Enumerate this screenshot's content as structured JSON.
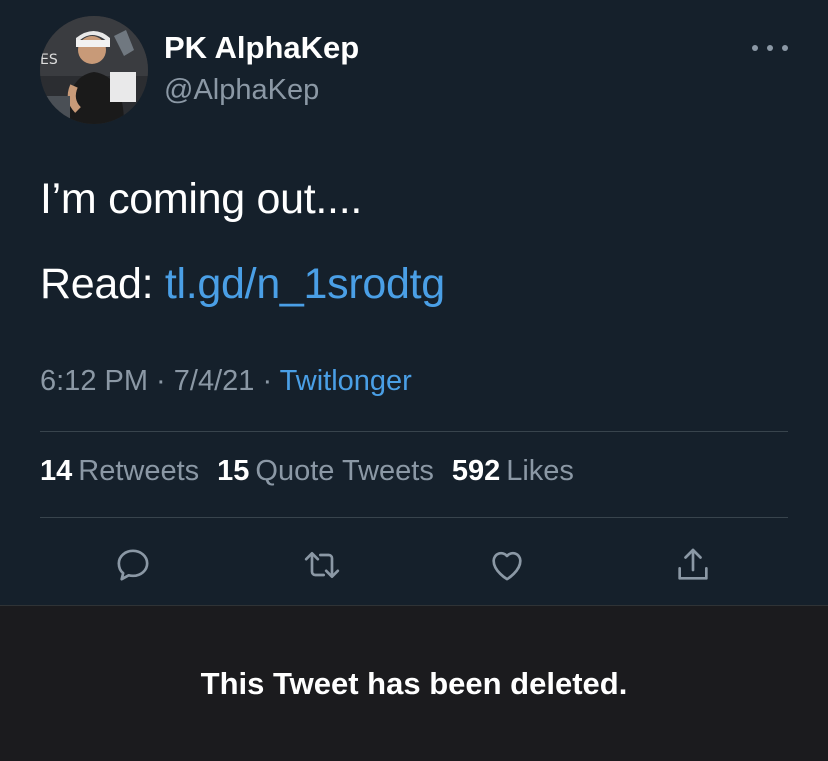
{
  "tweet": {
    "author": {
      "display_name": "PK AlphaKep",
      "handle": "@AlphaKep"
    },
    "text_line1": "I’m coming out....",
    "text_line2_prefix": "Read: ",
    "link_text": "tl.gd/n_1srodtg",
    "time": "6:12 PM",
    "separator": " · ",
    "date": "7/4/21",
    "source": "Twitlonger",
    "stats": {
      "retweets_count": "14",
      "retweets_label": "Retweets",
      "quotes_count": "15",
      "quotes_label": "Quote Tweets",
      "likes_count": "592",
      "likes_label": "Likes"
    },
    "actions": [
      "reply-icon",
      "retweet-icon",
      "like-icon",
      "share-icon"
    ]
  },
  "notice": {
    "text": "This Tweet has been deleted."
  },
  "colors": {
    "background": "#15202b",
    "link": "#4a9fe6",
    "muted": "#8b98a5",
    "divider": "#38444d"
  }
}
